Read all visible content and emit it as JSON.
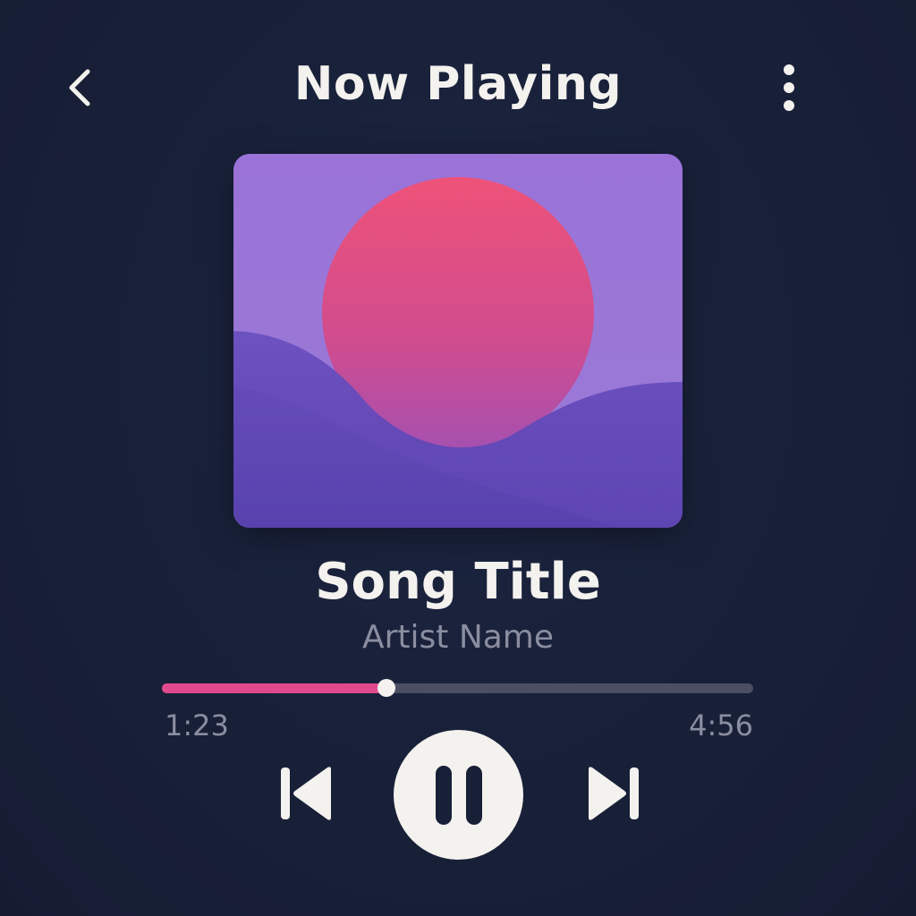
{
  "header": {
    "title": "Now Playing",
    "back_icon": "chevron-left-icon",
    "more_icon": "more-vertical-icon"
  },
  "track": {
    "title": "Song Title",
    "artist": "Artist Name"
  },
  "playback": {
    "elapsed": "1:23",
    "duration": "4:56",
    "progress_fraction": 0.38,
    "state": "playing"
  },
  "controls": {
    "previous_icon": "skip-previous-icon",
    "play_pause_icon": "pause-icon",
    "next_icon": "skip-next-icon"
  },
  "colors": {
    "background": "#182038",
    "accent": "#e04a8c",
    "track_inactive": "#4a4f63",
    "foreground": "#f4f2ee",
    "muted_text": "#8a8ea0",
    "art_sky": "#9a76d6",
    "art_sun": "#e4567f",
    "art_hill": "#6a4cba"
  }
}
